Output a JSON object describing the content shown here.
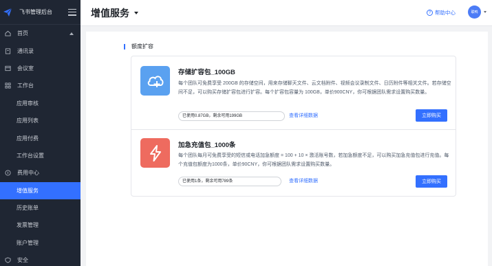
{
  "brand": {
    "title": "飞书管理后台"
  },
  "sidebar": {
    "items": [
      {
        "label": "首页",
        "icon": "home-icon"
      },
      {
        "label": "通讯录",
        "icon": "contacts-icon"
      },
      {
        "label": "会议室",
        "icon": "meeting-room-icon"
      },
      {
        "label": "工作台",
        "icon": "workplace-icon"
      },
      {
        "label": "应用审核"
      },
      {
        "label": "应用列表"
      },
      {
        "label": "应用付费"
      },
      {
        "label": "工作台设置"
      },
      {
        "label": "费用中心",
        "icon": "billing-icon"
      },
      {
        "label": "增值服务"
      },
      {
        "label": "历史账单"
      },
      {
        "label": "发票管理"
      },
      {
        "label": "账户管理"
      },
      {
        "label": "安全",
        "icon": "security-icon"
      }
    ]
  },
  "header": {
    "title": "增值服务",
    "help_label": "帮助中心",
    "avatar_text": "联鸭"
  },
  "section": {
    "title": "额度扩容"
  },
  "cards": [
    {
      "title": "存储扩容包_100GB",
      "icon": "cloud-plus-icon",
      "description": "每个团队可免费享受 200GB 的存储空间，用来存储聊天文件、云文档附件、视频会议录制文件、日历附件等相关文件。若存储空间不足，可以购买存储扩容包进行扩容。每个扩容包容量为 100GB，单价900CNY，你可根据团队需求设置购买数量。",
      "usage": "已使用0.87GB，剩余可用199GB",
      "detail_link": "查看详细数据",
      "buy_label": "立即购买"
    },
    {
      "title": "加急充值包_1000条",
      "icon": "lightning-icon",
      "description": "每个团队每月可免费享受的短信或电话加急额度 = 100 + 10 × 激活账号数，若加急额度不足，可以购买加急充值包进行充值。每个充值包额度为1000条，单价90CNY，你可根据团队需求设置购买数量。",
      "usage": "已使用1条，剩余可用789条",
      "detail_link": "查看详细数据",
      "buy_label": "立即购买"
    }
  ],
  "colors": {
    "accent": "#3370ff",
    "sidebar_bg": "#1f2633",
    "storage_icon": "#5aa1f0",
    "urgent_icon": "#ee6b5f"
  }
}
